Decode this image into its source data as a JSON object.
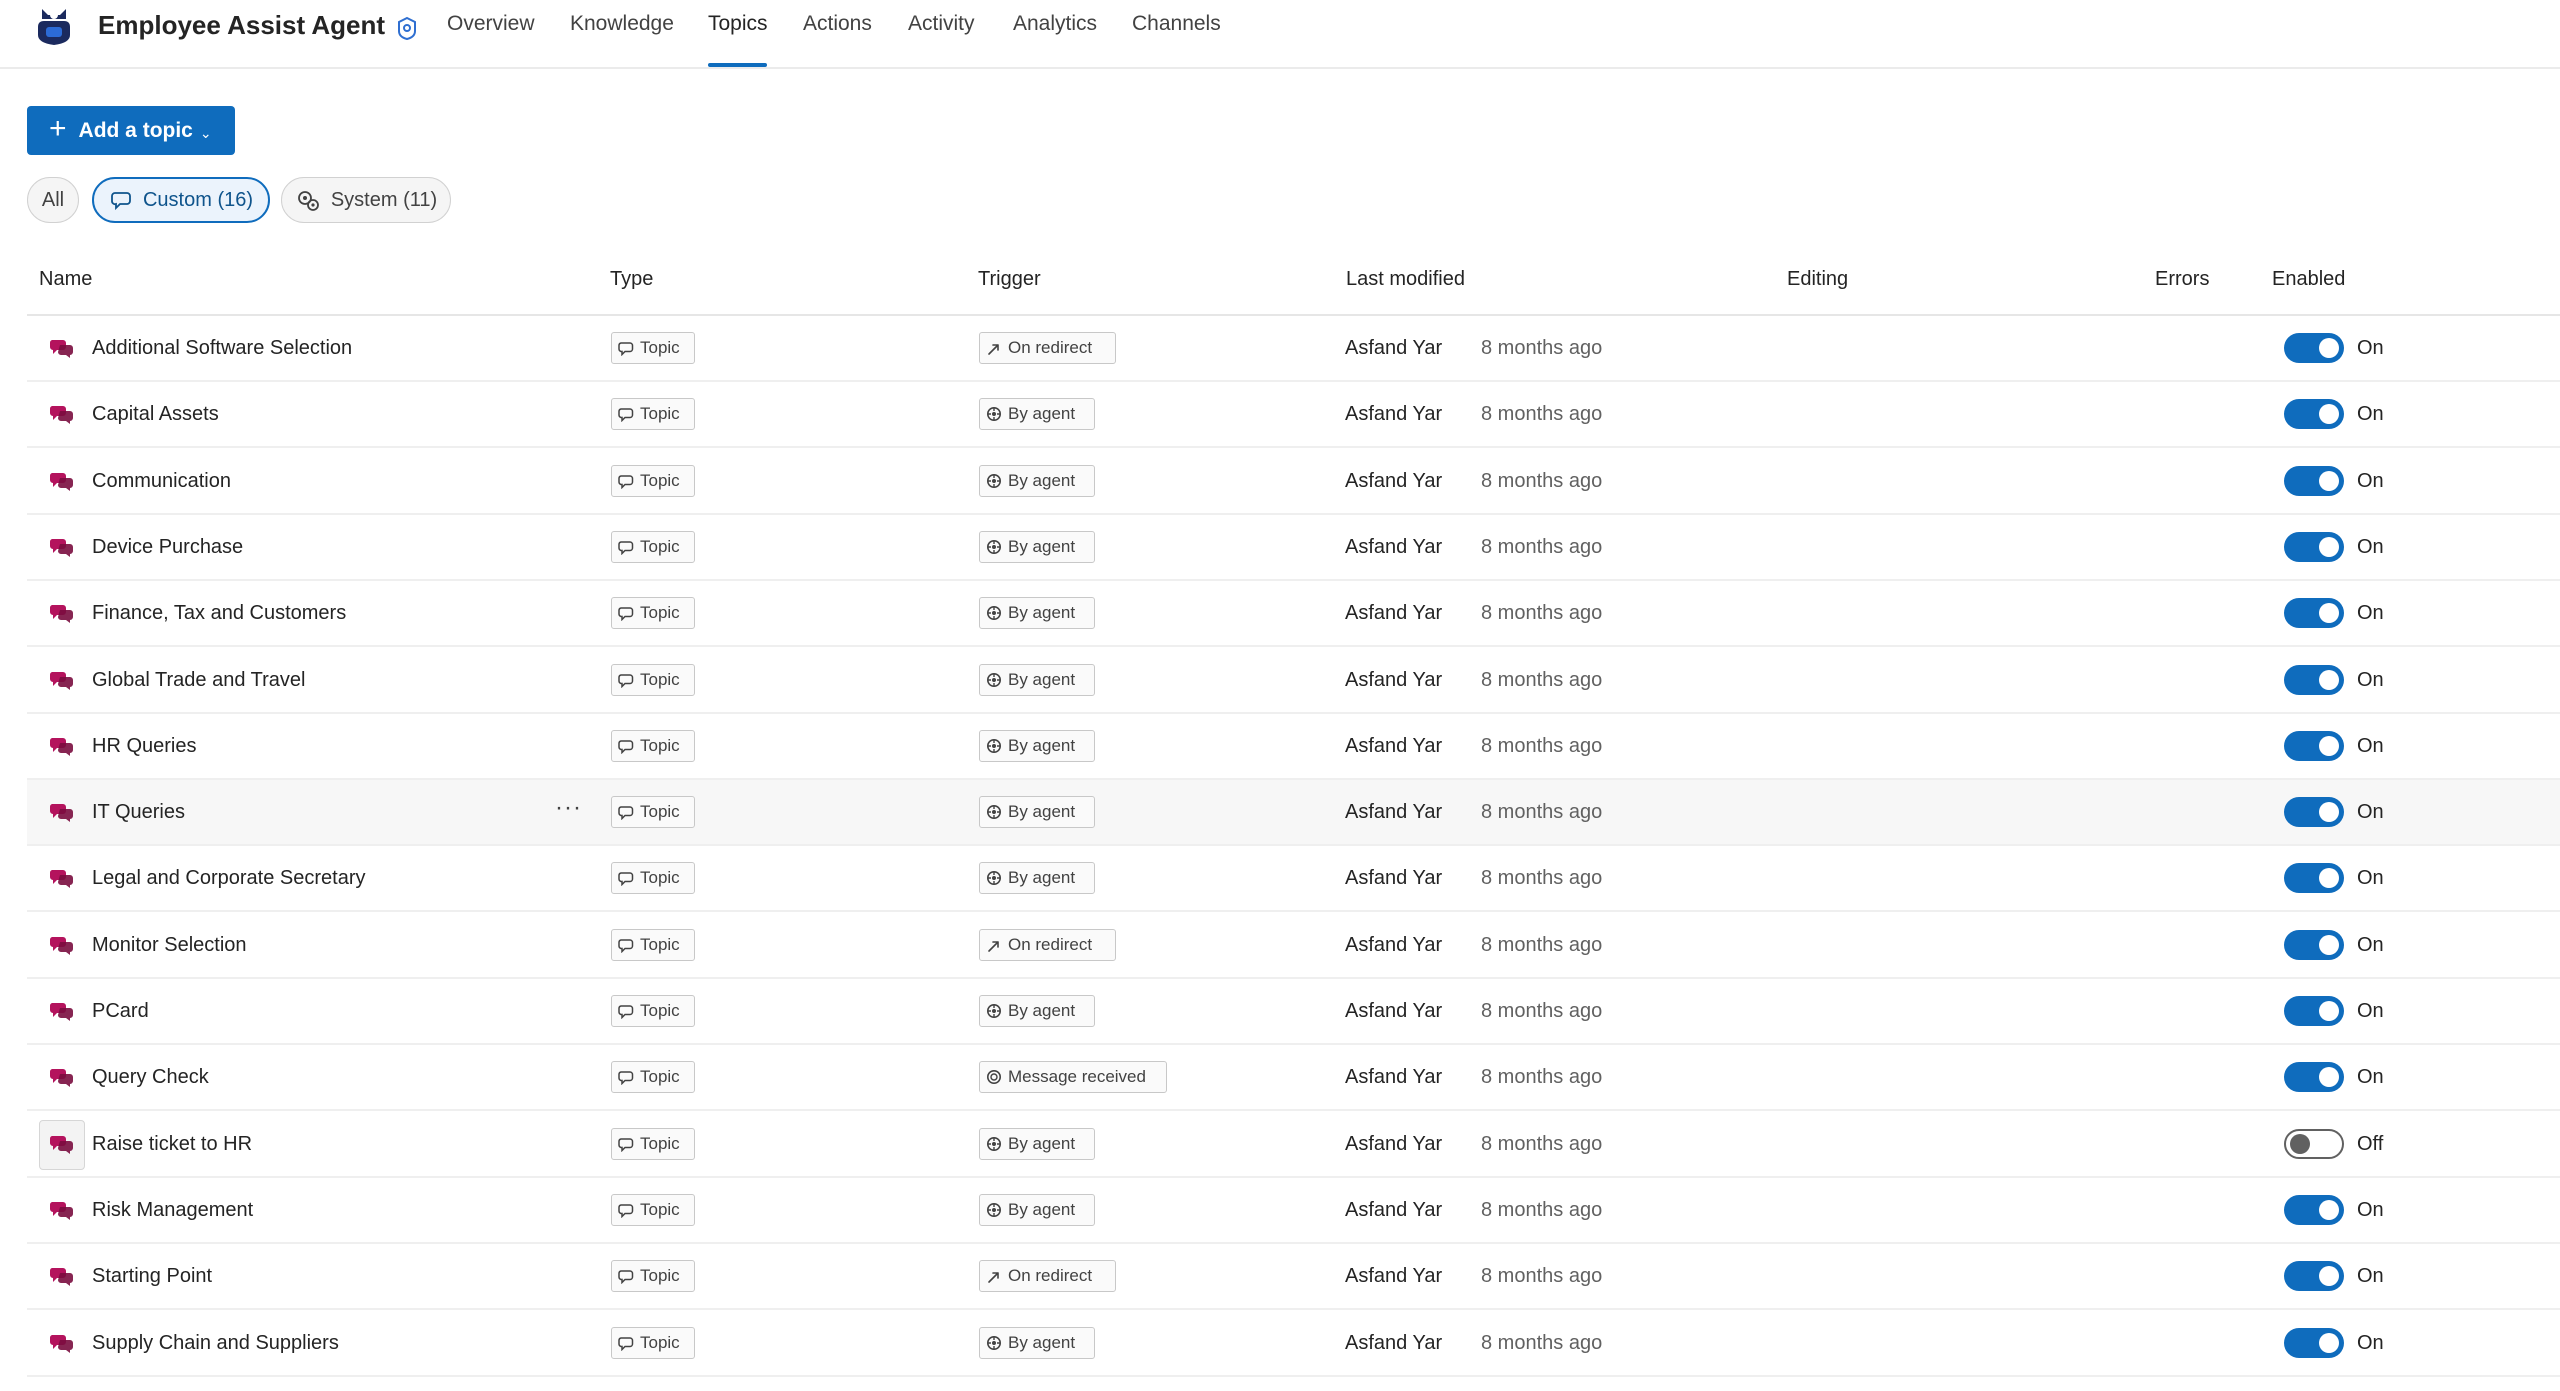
{
  "app": {
    "title": "Employee Assist Agent"
  },
  "nav": {
    "tabs": [
      {
        "label": "Overview"
      },
      {
        "label": "Knowledge"
      },
      {
        "label": "Topics",
        "active": true
      },
      {
        "label": "Actions"
      },
      {
        "label": "Activity"
      },
      {
        "label": "Analytics"
      },
      {
        "label": "Channels"
      }
    ]
  },
  "toolbar": {
    "add_label": "Add a topic"
  },
  "filters": [
    {
      "label": "All"
    },
    {
      "label": "Custom (16)",
      "selected": true
    },
    {
      "label": "System (11)"
    }
  ],
  "table": {
    "columns": [
      "Name",
      "Type",
      "Trigger",
      "Last modified",
      "Editing",
      "Errors",
      "Enabled"
    ],
    "rows": [
      {
        "name": "Additional Software Selection",
        "type": "Topic",
        "trigger": "On redirect",
        "author": "Asfand Yar",
        "time": "8 months ago",
        "enabled": "On"
      },
      {
        "name": "Capital Assets",
        "type": "Topic",
        "trigger": "By agent",
        "author": "Asfand Yar",
        "time": "8 months ago",
        "enabled": "On"
      },
      {
        "name": "Communication",
        "type": "Topic",
        "trigger": "By agent",
        "author": "Asfand Yar",
        "time": "8 months ago",
        "enabled": "On"
      },
      {
        "name": "Device Purchase",
        "type": "Topic",
        "trigger": "By agent",
        "author": "Asfand Yar",
        "time": "8 months ago",
        "enabled": "On"
      },
      {
        "name": "Finance, Tax and Customers",
        "type": "Topic",
        "trigger": "By agent",
        "author": "Asfand Yar",
        "time": "8 months ago",
        "enabled": "On"
      },
      {
        "name": "Global Trade and Travel",
        "type": "Topic",
        "trigger": "By agent",
        "author": "Asfand Yar",
        "time": "8 months ago",
        "enabled": "On"
      },
      {
        "name": "HR Queries",
        "type": "Topic",
        "trigger": "By agent",
        "author": "Asfand Yar",
        "time": "8 months ago",
        "enabled": "On"
      },
      {
        "name": "IT Queries",
        "type": "Topic",
        "trigger": "By agent",
        "author": "Asfand Yar",
        "time": "8 months ago",
        "enabled": "On",
        "more": "···"
      },
      {
        "name": "Legal and Corporate Secretary",
        "type": "Topic",
        "trigger": "By agent",
        "author": "Asfand Yar",
        "time": "8 months ago",
        "enabled": "On"
      },
      {
        "name": "Monitor Selection",
        "type": "Topic",
        "trigger": "On redirect",
        "author": "Asfand Yar",
        "time": "8 months ago",
        "enabled": "On"
      },
      {
        "name": "PCard",
        "type": "Topic",
        "trigger": "By agent",
        "author": "Asfand Yar",
        "time": "8 months ago",
        "enabled": "On"
      },
      {
        "name": "Query Check",
        "type": "Topic",
        "trigger": "Message received",
        "author": "Asfand Yar",
        "time": "8 months ago",
        "enabled": "On"
      },
      {
        "name": "Raise ticket to HR",
        "type": "Topic",
        "trigger": "By agent",
        "author": "Asfand Yar",
        "time": "8 months ago",
        "enabled": "Off"
      },
      {
        "name": "Risk Management",
        "type": "Topic",
        "trigger": "By agent",
        "author": "Asfand Yar",
        "time": "8 months ago",
        "enabled": "On"
      },
      {
        "name": "Starting Point",
        "type": "Topic",
        "trigger": "On redirect",
        "author": "Asfand Yar",
        "time": "8 months ago",
        "enabled": "On"
      },
      {
        "name": "Supply Chain and Suppliers",
        "type": "Topic",
        "trigger": "By agent",
        "author": "Asfand Yar",
        "time": "8 months ago",
        "enabled": "On"
      }
    ]
  },
  "colors": {
    "accent": "#0f6cbd",
    "topic_icon": "#b4135d"
  }
}
